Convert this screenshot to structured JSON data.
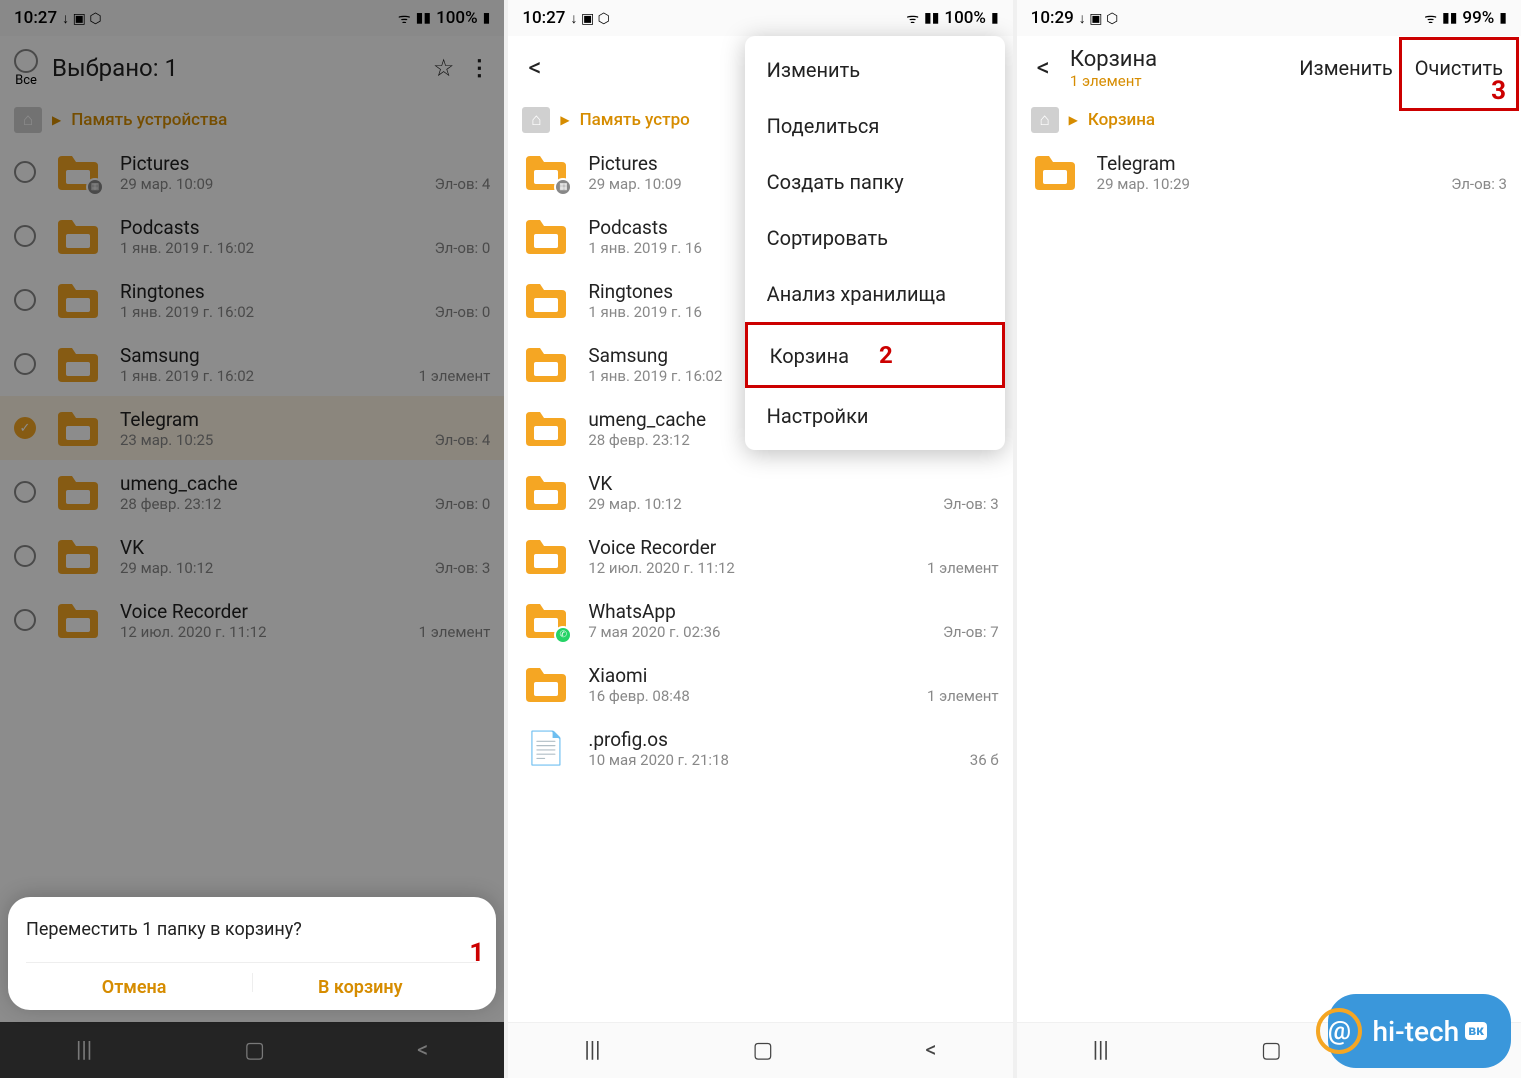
{
  "screens": {
    "s1": {
      "status": {
        "time": "10:27",
        "battery": "100%",
        "icons": "↓ ▣ ⬡",
        "right": "⚡ ᯤ ▮"
      },
      "header": {
        "select_all": "Все",
        "title": "Выбрано: 1"
      },
      "breadcrumb": "Память устройства",
      "rows": [
        {
          "name": "Pictures",
          "date": "29 мар. 10:09",
          "count": "Эл-ов: 4",
          "badge": "img"
        },
        {
          "name": "Podcasts",
          "date": "1 янв. 2019 г. 16:02",
          "count": "Эл-ов: 0"
        },
        {
          "name": "Ringtones",
          "date": "1 янв. 2019 г. 16:02",
          "count": "Эл-ов: 0"
        },
        {
          "name": "Samsung",
          "date": "1 янв. 2019 г. 16:02",
          "count": "1 элемент"
        },
        {
          "name": "Telegram",
          "date": "23 мар. 10:25",
          "count": "Эл-ов: 4",
          "selected": true
        },
        {
          "name": "umeng_cache",
          "date": "28 февр. 23:12",
          "count": "Эл-ов: 0"
        },
        {
          "name": "VK",
          "date": "29 мар. 10:12",
          "count": "Эл-ов: 3"
        },
        {
          "name": "Voice Recorder",
          "date": "12 июл. 2020 г. 11:12",
          "count": "1 элемент"
        }
      ],
      "sheet": {
        "title": "Переместить 1 папку в корзину?",
        "cancel": "Отмена",
        "confirm": "В корзину"
      },
      "annotation": "1"
    },
    "s2": {
      "status": {
        "time": "10:27",
        "battery": "100%",
        "icons": "↓ ▣ ⬡",
        "right": "⚡ ᯤ ▮"
      },
      "breadcrumb": "Память устро",
      "menu": {
        "items": [
          "Изменить",
          "Поделиться",
          "Создать папку",
          "Сортировать",
          "Анализ хранилища",
          "Корзина",
          "Настройки"
        ],
        "highlight_index": 5,
        "annotation": "2"
      },
      "rows": [
        {
          "name": "Pictures",
          "date": "29 мар. 10:09",
          "count": "",
          "badge": "img"
        },
        {
          "name": "Podcasts",
          "date": "1 янв. 2019 г. 16",
          "count": ""
        },
        {
          "name": "Ringtones",
          "date": "1 янв. 2019 г. 16",
          "count": ""
        },
        {
          "name": "Samsung",
          "date": "1 янв. 2019 г. 16:02",
          "count": "1 элемент"
        },
        {
          "name": "umeng_cache",
          "date": "28 февр. 23:12",
          "count": "Эл-ов: 0"
        },
        {
          "name": "VK",
          "date": "29 мар. 10:12",
          "count": "Эл-ов: 3"
        },
        {
          "name": "Voice Recorder",
          "date": "12 июл. 2020 г. 11:12",
          "count": "1 элемент"
        },
        {
          "name": "WhatsApp",
          "date": "7 мая 2020 г. 02:36",
          "count": "Эл-ов: 7",
          "badge": "wa"
        },
        {
          "name": "Xiaomi",
          "date": "16 февр. 08:48",
          "count": "1 элемент"
        },
        {
          "name": ".profig.os",
          "date": "10 мая 2020 г. 21:18",
          "count": "36 б",
          "doc": true
        }
      ]
    },
    "s3": {
      "status": {
        "time": "10:29",
        "battery": "99%",
        "icons": "↓ ▣ ⬡",
        "right": "⚡ ᯤ ▮"
      },
      "header": {
        "title": "Корзина",
        "subtitle": "1 элемент",
        "action_edit": "Изменить",
        "action_clear": "Очистить"
      },
      "breadcrumb": "Корзина",
      "rows": [
        {
          "name": "Telegram",
          "date": "29 мар. 10:29",
          "count": "Эл-ов: 3"
        }
      ],
      "annotation": "3"
    }
  },
  "watermark": "hi-tech",
  "watermark_badge": "вк"
}
